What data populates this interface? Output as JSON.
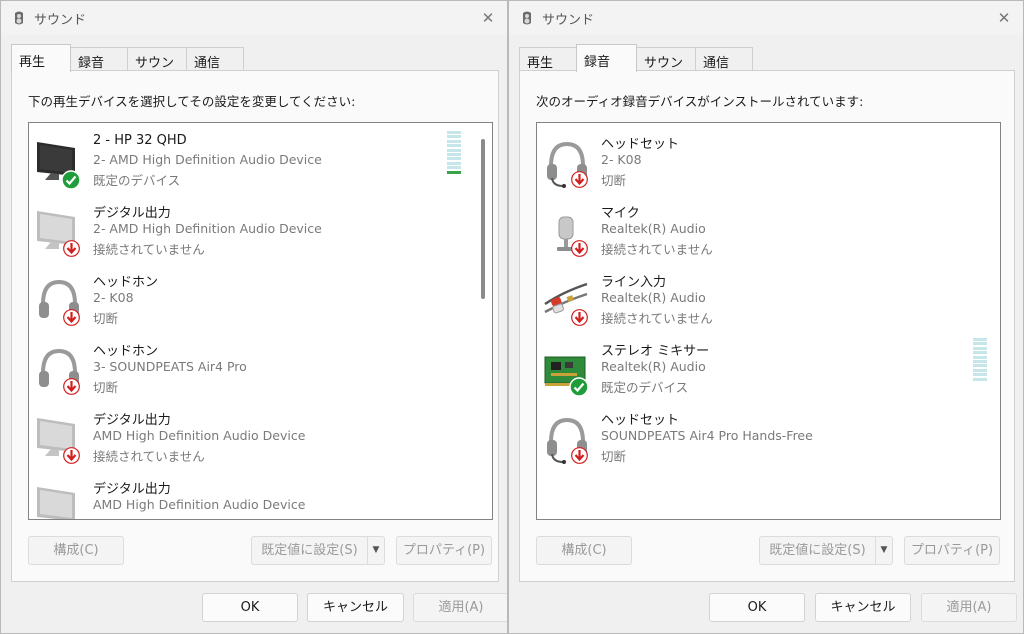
{
  "left": {
    "title": "サウンド",
    "close_glyph": "✕",
    "tabs": [
      {
        "label": "再生",
        "active": true
      },
      {
        "label": "録音",
        "active": false
      },
      {
        "label": "サウンド",
        "active": false
      },
      {
        "label": "通信",
        "active": false
      }
    ],
    "instruction": "下の再生デバイスを選択してその設定を変更してください:",
    "devices": [
      {
        "name": "2 - HP 32 QHD",
        "detail": "2- AMD High Definition Audio Device",
        "status": "既定のデバイス",
        "icon": "monitor-icon",
        "badge": "check-badge-icon"
      },
      {
        "name": "デジタル出力",
        "detail": "2- AMD High Definition Audio Device",
        "status": "接続されていません",
        "icon": "monitor-icon",
        "badge": "down-arrow-badge-icon"
      },
      {
        "name": "ヘッドホン",
        "detail": "2- K08",
        "status": "切断",
        "icon": "headphones-icon",
        "badge": "down-arrow-badge-icon"
      },
      {
        "name": "ヘッドホン",
        "detail": "3- SOUNDPEATS Air4 Pro",
        "status": "切断",
        "icon": "headphones-icon",
        "badge": "down-arrow-badge-icon"
      },
      {
        "name": "デジタル出力",
        "detail": "AMD High Definition Audio Device",
        "status": "接続されていません",
        "icon": "monitor-icon",
        "badge": "down-arrow-badge-icon"
      },
      {
        "name": "デジタル出力",
        "detail": "AMD High Definition Audio Device",
        "status": "",
        "icon": "monitor-icon",
        "badge": ""
      }
    ],
    "buttons": {
      "configure": "構成(C)",
      "set_default": "既定値に設定(S)",
      "split_arrow": "▼",
      "properties": "プロパティ(P)",
      "ok": "OK",
      "cancel": "キャンセル",
      "apply": "適用(A)"
    }
  },
  "right": {
    "title": "サウンド",
    "close_glyph": "✕",
    "tabs": [
      {
        "label": "再生",
        "active": false
      },
      {
        "label": "録音",
        "active": true
      },
      {
        "label": "サウンド",
        "active": false
      },
      {
        "label": "通信",
        "active": false
      }
    ],
    "instruction": "次のオーディオ録音デバイスがインストールされています:",
    "devices": [
      {
        "name": "ヘッドセット",
        "detail": "2- K08",
        "status": "切断",
        "icon": "headset-icon",
        "badge": "down-arrow-badge-icon"
      },
      {
        "name": "マイク",
        "detail": "Realtek(R) Audio",
        "status": "接続されていません",
        "icon": "microphone-icon",
        "badge": "down-arrow-badge-icon"
      },
      {
        "name": "ライン入力",
        "detail": "Realtek(R) Audio",
        "status": "接続されていません",
        "icon": "line-in-cable-icon",
        "badge": "down-arrow-badge-icon"
      },
      {
        "name": "ステレオ ミキサー",
        "detail": "Realtek(R) Audio",
        "status": "既定のデバイス",
        "icon": "sound-card-icon",
        "badge": "check-badge-icon"
      },
      {
        "name": "ヘッドセット",
        "detail": "SOUNDPEATS Air4 Pro Hands-Free",
        "status": "切断",
        "icon": "headset-icon",
        "badge": "down-arrow-badge-icon"
      }
    ],
    "buttons": {
      "configure": "構成(C)",
      "set_default": "既定値に設定(S)",
      "split_arrow": "▼",
      "properties": "プロパティ(P)",
      "ok": "OK",
      "cancel": "キャンセル",
      "apply": "適用(A)"
    }
  },
  "meters": {
    "playback_level": 0.1,
    "recording_level": 0.0
  },
  "colors": {
    "check_green": "#1f9d3a",
    "arrow_red": "#d11f1f",
    "meter_on": "#3aa24a",
    "meter_off": "#c6e6ea"
  }
}
